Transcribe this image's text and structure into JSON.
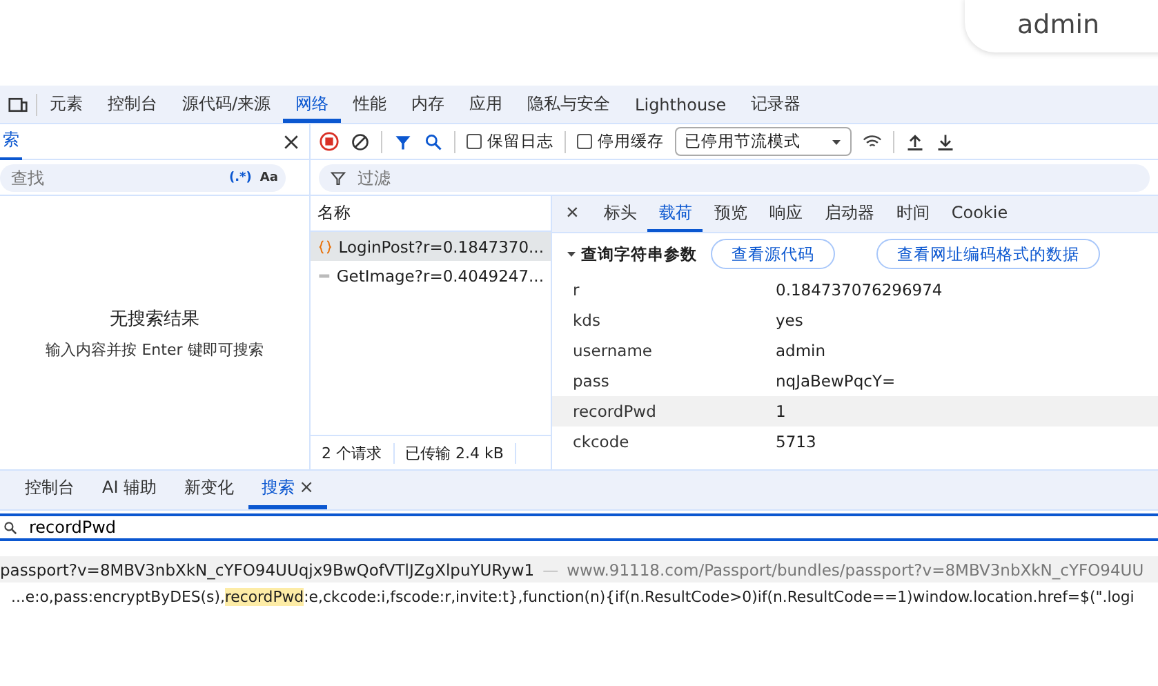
{
  "page": {
    "user_label": "admin"
  },
  "main_tabs": [
    {
      "label": "元素",
      "selected": false
    },
    {
      "label": "控制台",
      "selected": false
    },
    {
      "label": "源代码/来源",
      "selected": false
    },
    {
      "label": "网络",
      "selected": true
    },
    {
      "label": "性能",
      "selected": false
    },
    {
      "label": "内存",
      "selected": false
    },
    {
      "label": "应用",
      "selected": false
    },
    {
      "label": "隐私与安全",
      "selected": false
    },
    {
      "label": "Lighthouse",
      "selected": false
    },
    {
      "label": "记录器",
      "selected": false
    }
  ],
  "search_panel": {
    "title": "索",
    "placeholder": "查找",
    "regex_label": "(.*)",
    "case_label": "Aa",
    "empty_title": "无搜索结果",
    "empty_hint": "输入内容并按 Enter 键即可搜索"
  },
  "network_toolbar": {
    "recording": true,
    "preserve_log": {
      "label": "保留日志",
      "checked": false
    },
    "disable_cache": {
      "label": "停用缓存",
      "checked": false
    },
    "throttling": "已停用节流模式",
    "filter_placeholder": "过滤"
  },
  "requests": {
    "header": "名称",
    "rows": [
      {
        "kind": "script",
        "name": "LoginPost?r=0.1847370...",
        "selected": true
      },
      {
        "kind": "image",
        "name": "GetImage?r=0.4049247...",
        "selected": false
      }
    ],
    "status": [
      "2 个请求",
      "已传输 2.4 kB"
    ]
  },
  "detail": {
    "close": "×",
    "tabs": [
      {
        "label": "标头",
        "selected": false
      },
      {
        "label": "载荷",
        "selected": true
      },
      {
        "label": "预览",
        "selected": false
      },
      {
        "label": "响应",
        "selected": false
      },
      {
        "label": "启动器",
        "selected": false
      },
      {
        "label": "时间",
        "selected": false
      },
      {
        "label": "Cookie",
        "selected": false
      }
    ],
    "section": {
      "title": "查询字符串参数",
      "expanded": true,
      "buttons": [
        "查看源代码",
        "查看网址编码格式的数据"
      ]
    },
    "params": [
      {
        "key": "r",
        "value": "0.184737076296974",
        "selected": false
      },
      {
        "key": "kds",
        "value": "yes",
        "selected": false
      },
      {
        "key": "username",
        "value": "admin",
        "selected": false
      },
      {
        "key": "pass",
        "value": "nqJaBewPqcY=",
        "selected": false
      },
      {
        "key": "recordPwd",
        "value": "1",
        "selected": true
      },
      {
        "key": "ckcode",
        "value": "5713",
        "selected": false
      }
    ]
  },
  "drawer": {
    "tabs": [
      {
        "label": "控制台",
        "selected": false,
        "closable": false
      },
      {
        "label": "AI 辅助",
        "selected": false,
        "closable": false
      },
      {
        "label": "新变化",
        "selected": false,
        "closable": false
      },
      {
        "label": "搜索",
        "selected": true,
        "closable": true
      }
    ],
    "close_glyph": "×",
    "query": "recordPwd",
    "results": [
      {
        "file": "passport?v=8MBV3nbXkN_cYFO94UUqjx9BwQofVTlJZgXlpuYURyw1",
        "separator": "—",
        "url": "www.91118.com/Passport/bundles/passport?v=8MBV3nbXkN_cYFO94UU",
        "lines": [
          {
            "before": "...e:o,pass:encryptByDES(s),",
            "match": "recordPwd",
            "after": ":e,ckcode:i,fscode:r,invite:t},function(n){if(n.ResultCode>0)if(n.ResultCode==1)window.location.href=$(\".logi"
          }
        ]
      }
    ]
  }
}
